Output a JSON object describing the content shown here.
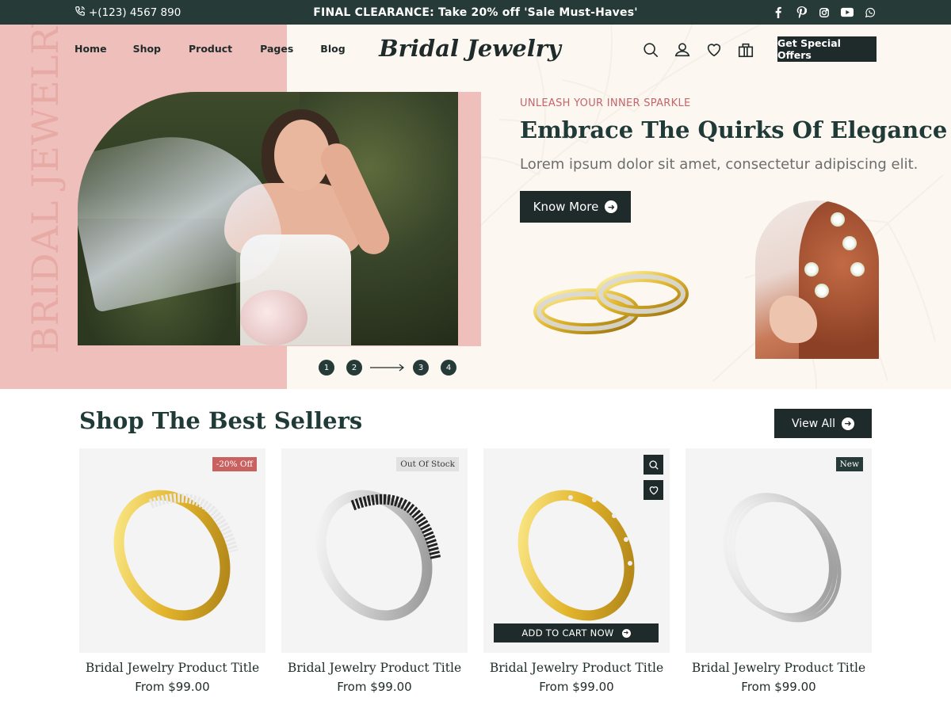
{
  "topbar": {
    "phone": "+(123) 4567 890",
    "promo": "FINAL CLEARANCE: Take 20% off 'Sale Must-Haves'",
    "social": [
      "facebook-icon",
      "pinterest-icon",
      "instagram-icon",
      "youtube-icon",
      "whatsapp-icon"
    ]
  },
  "nav": {
    "items": [
      "Home",
      "Shop",
      "Product",
      "Pages",
      "Blog"
    ]
  },
  "logo": "Bridal Jewelry",
  "header": {
    "icons": [
      "search-icon",
      "user-icon",
      "heart-icon",
      "shopping-bag-icon"
    ],
    "offers_label": "Get Special Offers"
  },
  "hero": {
    "vertical_text": "BRIDAL JEWELRY",
    "eyebrow": "UNLEASH YOUR INNER SPARKLE",
    "title": "Embrace The Quirks Of Elegance",
    "subtitle": "Lorem ipsum dolor sit amet, consectetur adipiscing elit.",
    "button_label": "Know More",
    "slides": [
      "1",
      "2",
      "3",
      "4"
    ]
  },
  "bestsellers": {
    "title": "Shop The Best Sellers",
    "view_all_label": "View All",
    "add_to_cart_label": "ADD TO CART NOW",
    "products": [
      {
        "title": "Bridal Jewelry Product Title",
        "price": "From $99.00",
        "badge": "-20% Off",
        "metal": "gold",
        "stones": "white"
      },
      {
        "title": "Bridal Jewelry Product Title",
        "price": "From $99.00",
        "badge": "Out Of Stock",
        "metal": "silver",
        "stones": "black"
      },
      {
        "title": "Bridal Jewelry Product Title",
        "price": "From $99.00",
        "badge": "",
        "metal": "gold",
        "stones": "dots"
      },
      {
        "title": "Bridal Jewelry Product Title",
        "price": "From $99.00",
        "badge": "New",
        "metal": "silver",
        "stones": "bands"
      }
    ]
  },
  "colors": {
    "dark": "#1f2b2a",
    "topbar": "#263b38",
    "pink": "#efbfbb",
    "cream": "#fdf7f1",
    "accent": "#c3656c"
  }
}
